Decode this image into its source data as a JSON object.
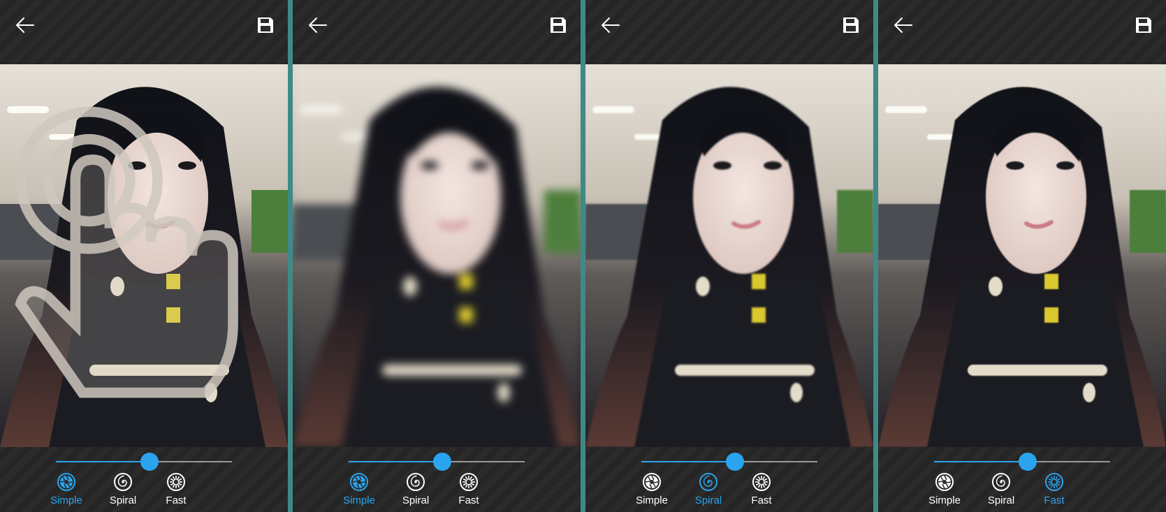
{
  "screens": [
    {
      "id": "simple",
      "selected_mode": "simple",
      "slider_value": 0.53,
      "blur": "none"
    },
    {
      "id": "simple-blurred",
      "selected_mode": "simple",
      "slider_value": 0.53,
      "blur": "gaussian"
    },
    {
      "id": "spiral",
      "selected_mode": "spiral",
      "slider_value": 0.53,
      "blur": "spiral"
    },
    {
      "id": "fast",
      "selected_mode": "fast",
      "slider_value": 0.53,
      "blur": "fast"
    }
  ],
  "modes": [
    {
      "key": "simple",
      "label": "Simple",
      "icon": "aperture-icon"
    },
    {
      "key": "spiral",
      "label": "Spiral",
      "icon": "spiral-icon"
    },
    {
      "key": "fast",
      "label": "Fast",
      "icon": "starburst-icon"
    }
  ],
  "toolbar": {
    "back_icon": "back-arrow-icon",
    "save_icon": "save-icon"
  },
  "colors": {
    "accent": "#2aa4ee",
    "inactive": "#ffffff",
    "divider": "#3f8a86",
    "bar": "#2b2b2b"
  },
  "hint": {
    "icon": "touch-hand-icon"
  }
}
